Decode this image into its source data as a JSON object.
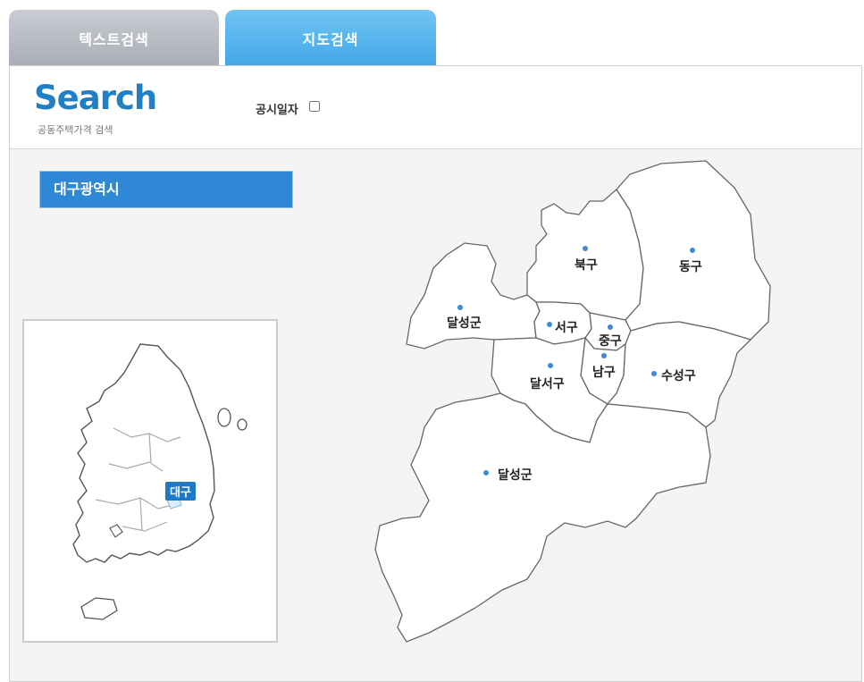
{
  "tabs": {
    "text_search": "텍스트검색",
    "map_search": "지도검색"
  },
  "header": {
    "logo": "Search",
    "logo_sub": "공동주택가격 검색",
    "date_label": "공시일자"
  },
  "region_title": "대구광역시",
  "korea_map": {
    "highlight_label": "대구"
  },
  "districts": {
    "buk": "북구",
    "dong": "동구",
    "dalseong_north": "달성군",
    "seo": "서구",
    "jung": "중구",
    "nam": "남구",
    "dalseo": "달서구",
    "suseong": "수성구",
    "dalseong_south": "달성군"
  },
  "colors": {
    "accent": "#2e88d6",
    "tab_active": "#4aace9",
    "tab_inactive": "#b3b7be",
    "dot": "#3c8ad8"
  }
}
